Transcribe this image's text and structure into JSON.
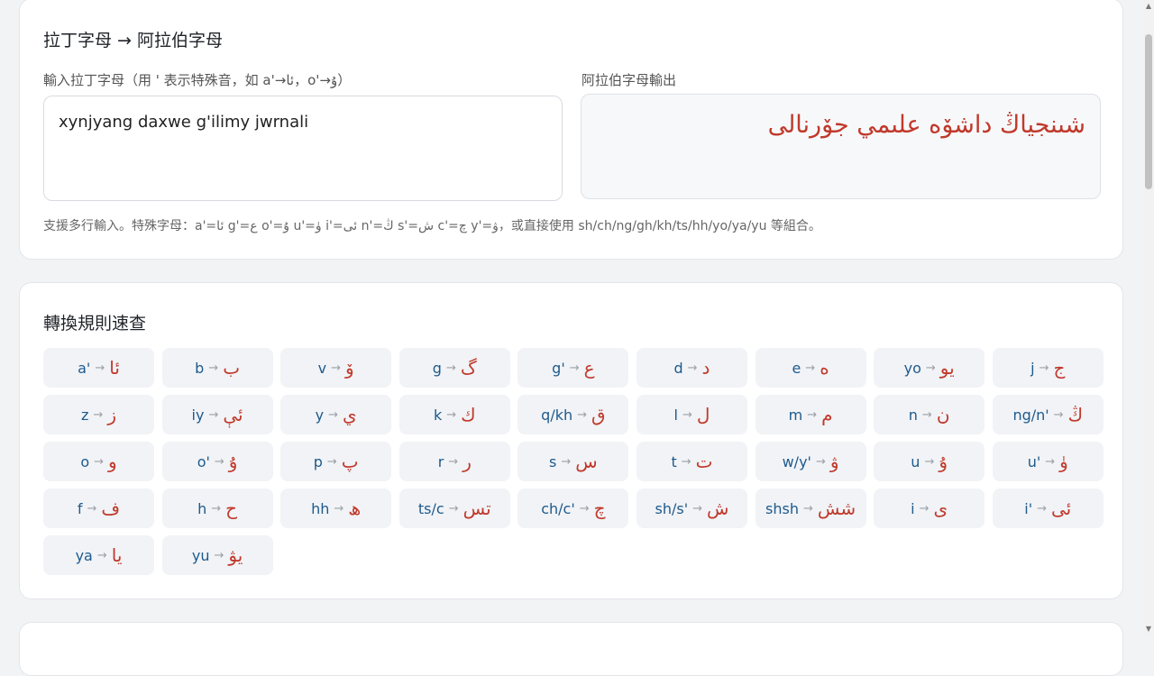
{
  "converter": {
    "title": "拉丁字母 → 阿拉伯字母",
    "input_label": "輸入拉丁字母（用 ' 表示特殊音，如 a'→ئا，o'→ۇ）",
    "input_value": "xynjyang daxwe g'ilimy jwrnali",
    "output_label": "阿拉伯字母輸出",
    "output_value": "شىنجياڭ داشۆە علىمي جۆرنالى",
    "hint": "支援多行輸入。特殊字母：a'=ئا g'=ع o'=ۇ u'=ۈ i'=ئى n'=ڭ s'=ش c'=چ y'=ۋ，或直接使用 sh/ch/ng/gh/kh/ts/hh/yo/ya/yu 等組合。"
  },
  "rules": {
    "title": "轉換規則速查",
    "items": [
      {
        "lat": "a'",
        "ar": "ئا"
      },
      {
        "lat": "b",
        "ar": "ب"
      },
      {
        "lat": "v",
        "ar": "ۆ"
      },
      {
        "lat": "g",
        "ar": "گ"
      },
      {
        "lat": "g'",
        "ar": "ع"
      },
      {
        "lat": "d",
        "ar": "د"
      },
      {
        "lat": "e",
        "ar": "ە"
      },
      {
        "lat": "yo",
        "ar": "يو"
      },
      {
        "lat": "j",
        "ar": "ج"
      },
      {
        "lat": "z",
        "ar": "ز"
      },
      {
        "lat": "iy",
        "ar": "ئې"
      },
      {
        "lat": "y",
        "ar": "ي"
      },
      {
        "lat": "k",
        "ar": "ك"
      },
      {
        "lat": "q/kh",
        "ar": "ق"
      },
      {
        "lat": "l",
        "ar": "ل"
      },
      {
        "lat": "m",
        "ar": "م"
      },
      {
        "lat": "n",
        "ar": "ن"
      },
      {
        "lat": "ng/n'",
        "ar": "ڭ"
      },
      {
        "lat": "o",
        "ar": "و"
      },
      {
        "lat": "o'",
        "ar": "ۇ"
      },
      {
        "lat": "p",
        "ar": "پ"
      },
      {
        "lat": "r",
        "ar": "ر"
      },
      {
        "lat": "s",
        "ar": "س"
      },
      {
        "lat": "t",
        "ar": "ت"
      },
      {
        "lat": "w/y'",
        "ar": "ۋ"
      },
      {
        "lat": "u",
        "ar": "ۇ"
      },
      {
        "lat": "u'",
        "ar": "ۈ"
      },
      {
        "lat": "f",
        "ar": "ف"
      },
      {
        "lat": "h",
        "ar": "ح"
      },
      {
        "lat": "hh",
        "ar": "ھ"
      },
      {
        "lat": "ts/c",
        "ar": "تس"
      },
      {
        "lat": "ch/c'",
        "ar": "چ"
      },
      {
        "lat": "sh/s'",
        "ar": "ش"
      },
      {
        "lat": "shsh",
        "ar": "شش"
      },
      {
        "lat": "i",
        "ar": "ى"
      },
      {
        "lat": "i'",
        "ar": "ئى"
      },
      {
        "lat": "ya",
        "ar": "يا"
      },
      {
        "lat": "yu",
        "ar": "يۋ"
      }
    ]
  },
  "arrow": "→",
  "colors": {
    "latin": "#1e5a8c",
    "arabic": "#c0392b",
    "chip_bg": "#f1f3f6",
    "page_bg": "#f2f3f5"
  }
}
